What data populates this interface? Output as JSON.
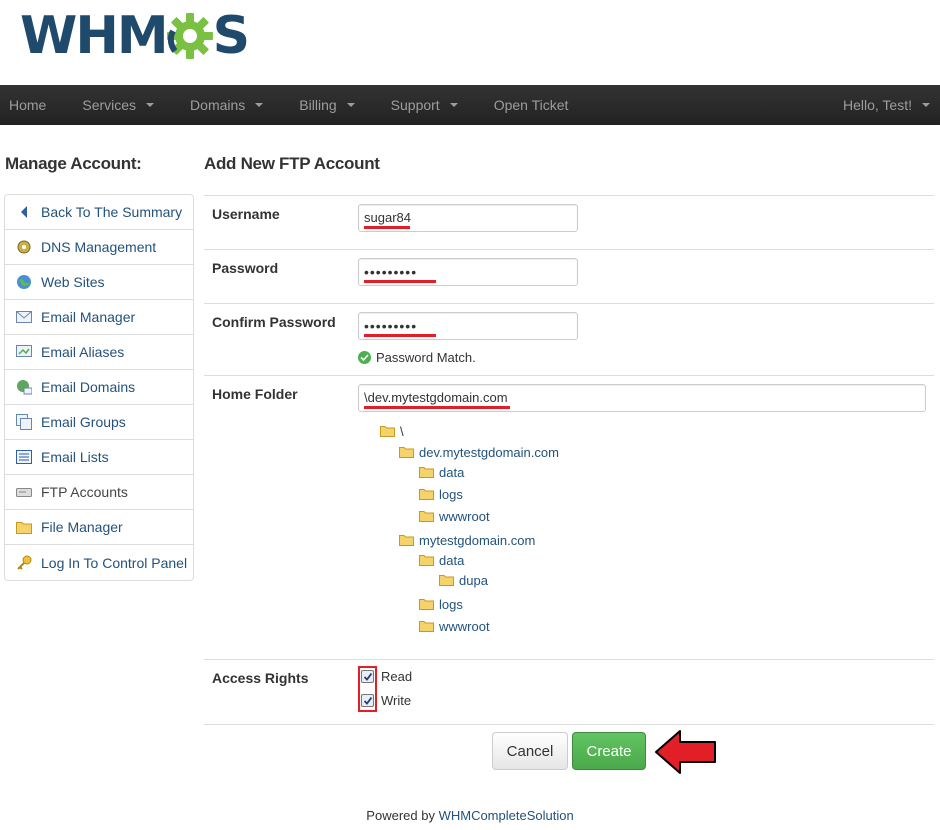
{
  "logo": {
    "text_left": "WHM",
    "text_right": "S"
  },
  "nav": {
    "items": [
      {
        "label": "Home",
        "dropdown": false
      },
      {
        "label": "Services",
        "dropdown": true
      },
      {
        "label": "Domains",
        "dropdown": true
      },
      {
        "label": "Billing",
        "dropdown": true
      },
      {
        "label": "Support",
        "dropdown": true
      },
      {
        "label": "Open Ticket",
        "dropdown": false
      }
    ],
    "user": "Hello, Test!"
  },
  "sidebar": {
    "title": "Manage Account:",
    "items": [
      {
        "label": "Back To The Summary",
        "icon": "back-arrow-icon"
      },
      {
        "label": "DNS Management",
        "icon": "dns-icon"
      },
      {
        "label": "Web Sites",
        "icon": "globe-icon"
      },
      {
        "label": "Email Manager",
        "icon": "mail-icon"
      },
      {
        "label": "Email Aliases",
        "icon": "mail-alias-icon"
      },
      {
        "label": "Email Domains",
        "icon": "mail-domain-icon"
      },
      {
        "label": "Email Groups",
        "icon": "mail-group-icon"
      },
      {
        "label": "Email Lists",
        "icon": "list-icon"
      },
      {
        "label": "FTP Accounts",
        "icon": "ftp-icon"
      },
      {
        "label": "File Manager",
        "icon": "folder-icon"
      },
      {
        "label": "Log In To Control Panel",
        "icon": "key-icon"
      }
    ]
  },
  "form": {
    "title": "Add New FTP Account",
    "username_label": "Username",
    "username_value": "sugar84",
    "password_label": "Password",
    "password_value": "•••••••••",
    "confirm_label": "Confirm Password",
    "confirm_value": "•••••••••",
    "password_match": "Password Match.",
    "home_label": "Home Folder",
    "home_value": "\\dev.mytestgdomain.com",
    "access_label": "Access Rights",
    "read_label": "Read",
    "write_label": "Write",
    "read_checked": true,
    "write_checked": true,
    "cancel_label": "Cancel",
    "create_label": "Create"
  },
  "tree": [
    {
      "label": "\\",
      "level": 0
    },
    {
      "label": "dev.mytestgdomain.com",
      "level": 1
    },
    {
      "label": "data",
      "level": 2
    },
    {
      "label": "logs",
      "level": 2
    },
    {
      "label": "wwwroot",
      "level": 2
    },
    {
      "label": "mytestgdomain.com",
      "level": 1
    },
    {
      "label": "data",
      "level": 2
    },
    {
      "label": "dupa",
      "level": 3
    },
    {
      "label": "logs",
      "level": 2
    },
    {
      "label": "wwwroot",
      "level": 2
    }
  ],
  "footer": {
    "prefix": "Powered by",
    "link": "WHMCompleteSolution"
  },
  "colors": {
    "navbar": "#2c2c2c",
    "link": "#23527c",
    "highlight": "#e21f26",
    "create": "#5cb85c",
    "logo_blue": "#1f4a6b",
    "logo_green": "#7ac143"
  }
}
